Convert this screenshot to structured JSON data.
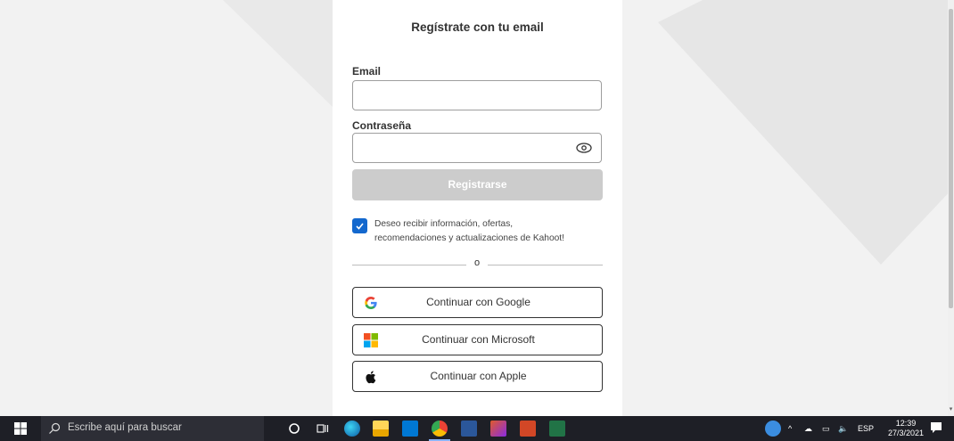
{
  "form": {
    "title": "Regístrate con tu email",
    "email_label": "Email",
    "email_value": "",
    "password_label": "Contraseña",
    "password_value": "",
    "register_label": "Registrarse",
    "consent_checked": true,
    "consent_text_line1": "Deseo recibir información, ofertas,",
    "consent_text_line2": "recomendaciones y actualizaciones de Kahoot!",
    "or_text": "o",
    "google_label": "Continuar con Google",
    "microsoft_label": "Continuar con Microsoft",
    "apple_label": "Continuar con Apple"
  },
  "taskbar": {
    "search_placeholder": "Escribe aquí para buscar",
    "language": "ESP",
    "time": "12:39",
    "date": "27/3/2021",
    "apps": [
      "cortana-icon",
      "task-view-icon",
      "edge-icon",
      "file-explorer-icon",
      "mail-icon",
      "chrome-icon",
      "word-icon",
      "app-icon",
      "powerpoint-icon",
      "excel-icon"
    ]
  },
  "colors": {
    "primary_blue": "#1368ce",
    "disabled_button": "#cccccc",
    "taskbar": "#1e1f26"
  }
}
